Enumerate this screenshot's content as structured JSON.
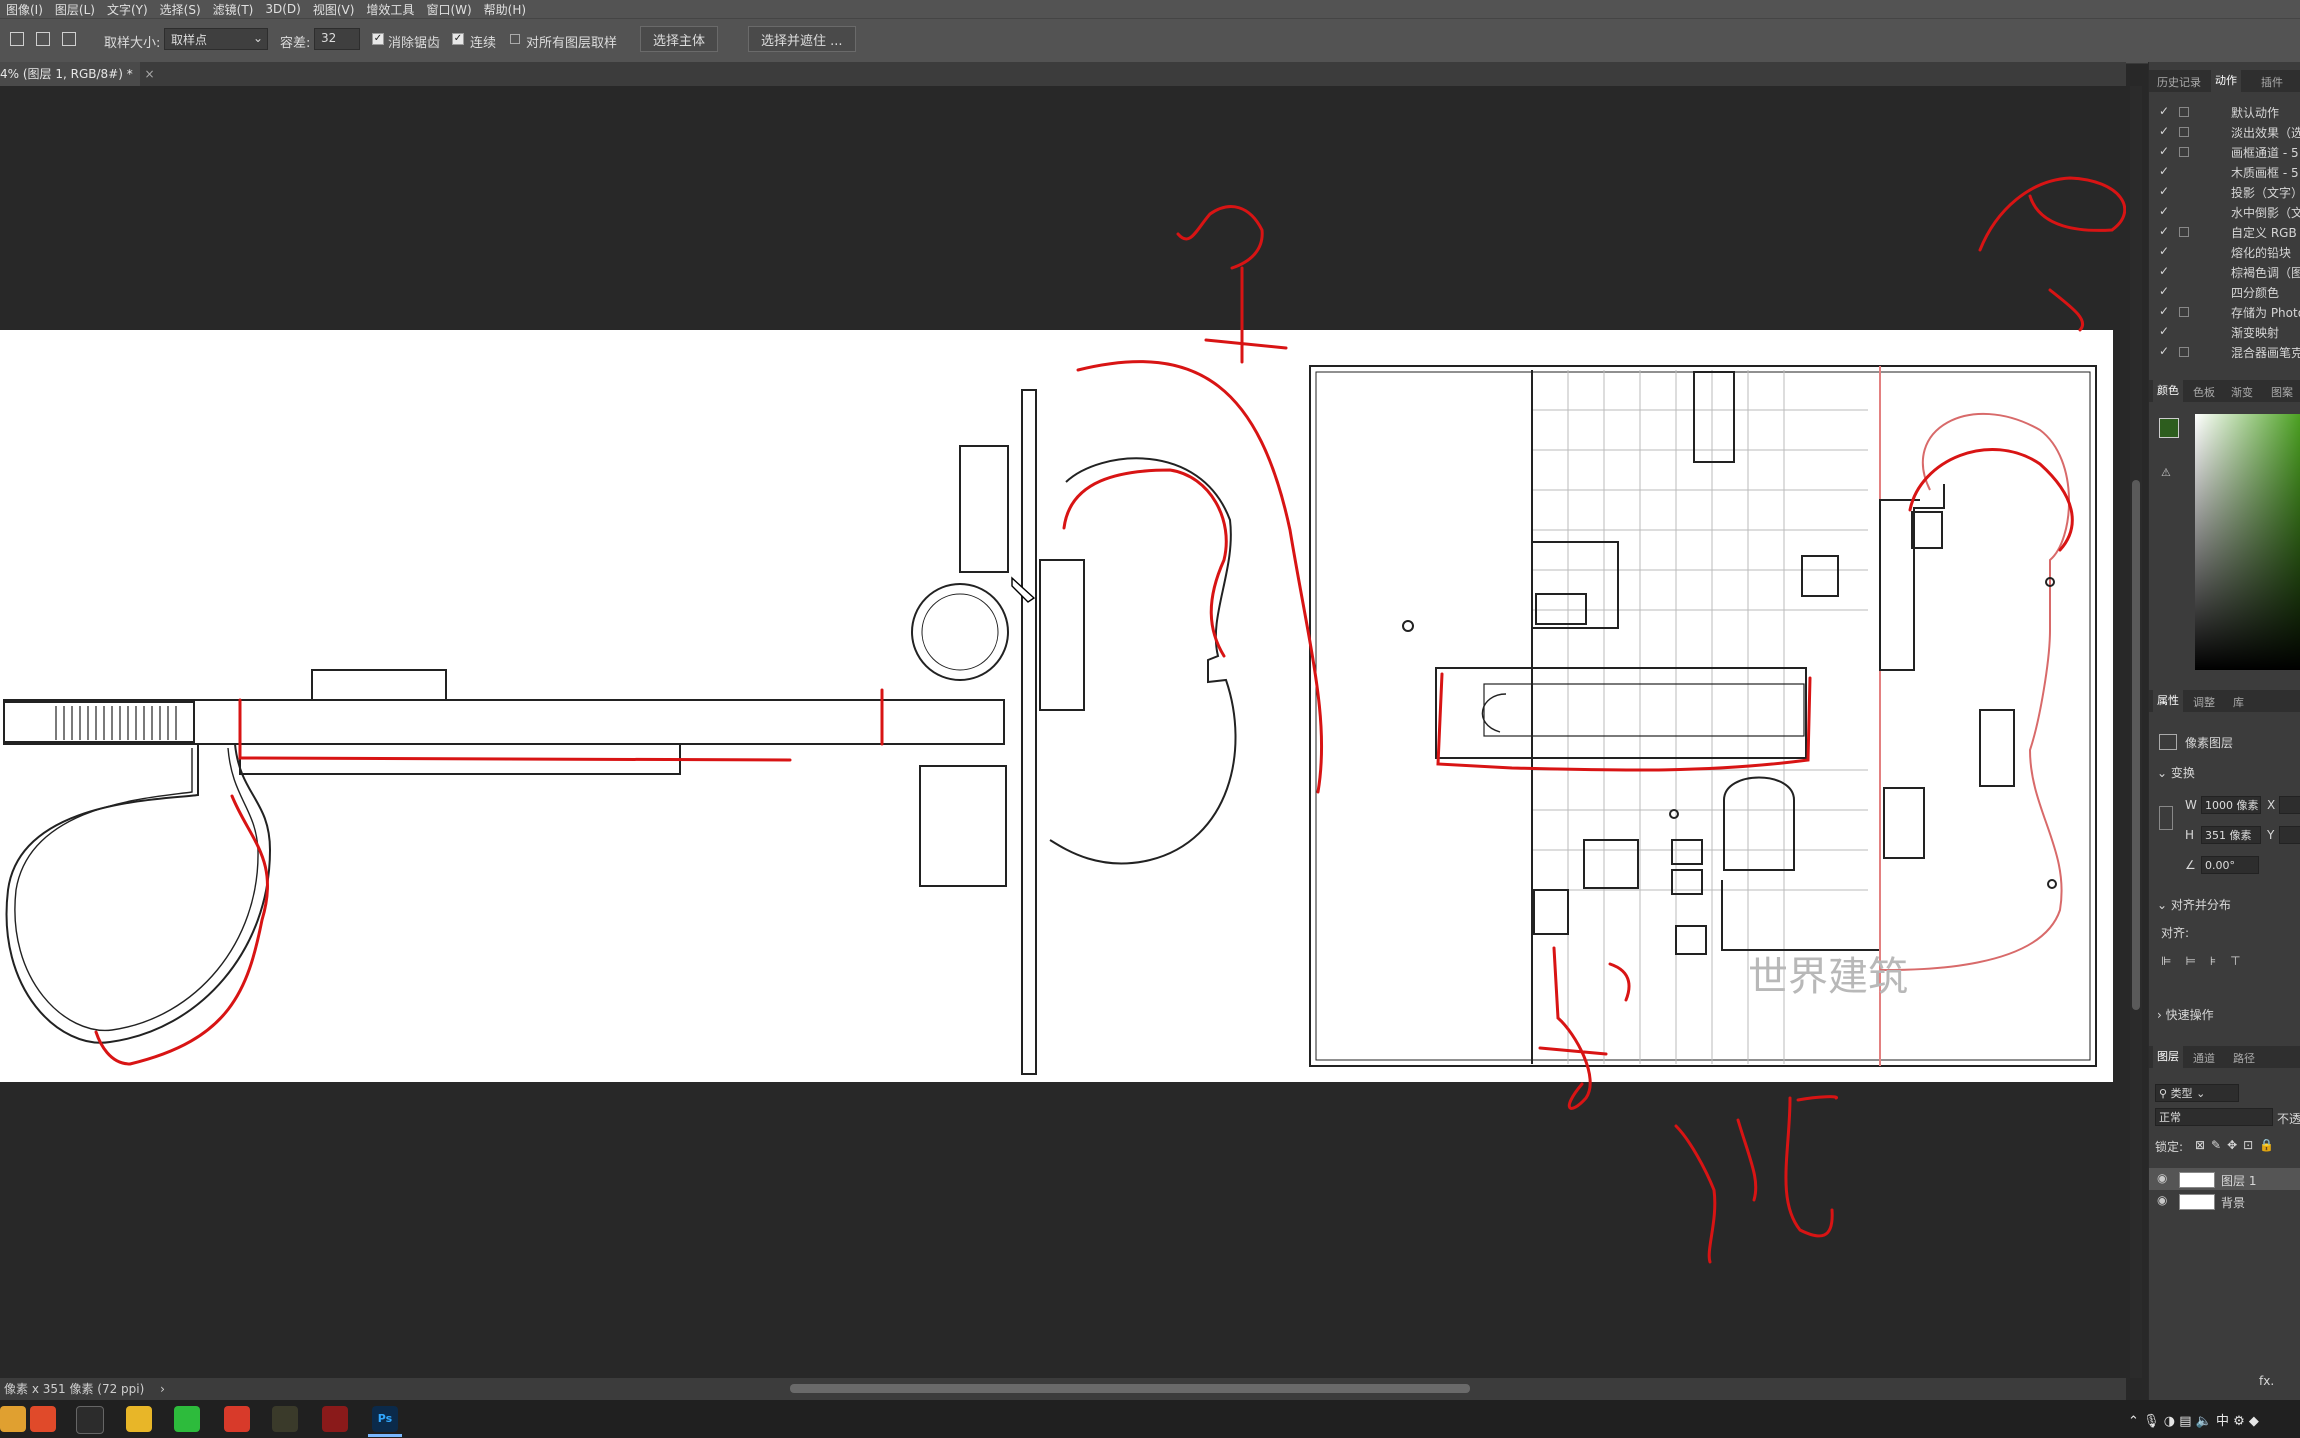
{
  "menu": [
    "图像(I)",
    "图层(L)",
    "文字(Y)",
    "选择(S)",
    "滤镜(T)",
    "3D(D)",
    "视图(V)",
    "增效工具",
    "窗口(W)",
    "帮助(H)"
  ],
  "options": {
    "sample_size_label": "取样大小:",
    "sample_size_value": "取样点",
    "tolerance_label": "容差:",
    "tolerance_value": "32",
    "antialias_label": "消除锯齿",
    "contiguous_label": "连续",
    "all_layers_label": "对所有图层取样",
    "select_subject": "选择主体",
    "select_mask": "选择并遮住 ..."
  },
  "document_tab": "4% (图层 1, RGB/8#) *",
  "status_text": "像素 x 351 像素 (72 ppi)",
  "panels": {
    "top_tabs": [
      "历史记录",
      "动作",
      "插件"
    ],
    "actions": [
      "默认动作",
      "淡出效果（选",
      "画框通道 - 5",
      "木质画框 - 5",
      "投影（文字）",
      "水中倒影（文",
      "自定义 RGB",
      "熔化的铅块",
      "棕褐色调（图",
      "四分颜色",
      "存储为 Photo",
      "渐变映射",
      "混合器画笔克"
    ],
    "color_tabs": [
      "颜色",
      "色板",
      "渐变",
      "图案"
    ],
    "props_tabs": [
      "属性",
      "调整",
      "库"
    ],
    "pixel_layer": "像素图层",
    "transform_label": "变换",
    "w_label": "W",
    "w_value": "1000 像素",
    "h_label": "H",
    "h_value": "351 像素",
    "x_label": "X",
    "y_label": "Y",
    "angle_value": "0.00°",
    "align_label": "对齐并分布",
    "align_to_label": "对齐:",
    "quick_actions": "快速操作",
    "layers_tabs": [
      "图层",
      "通道",
      "路径"
    ],
    "kind_label": "类型",
    "blend_mode": "正常",
    "opacity_label": "不透",
    "lock_label": "锁定:",
    "layers": [
      "图层 1",
      "背景"
    ]
  },
  "watermark": "世界建筑",
  "annotations": [
    "四",
    "单",
    "三",
    "卡",
    "代"
  ],
  "colors": {
    "chrome": "#535353",
    "canvas": "#282828",
    "panel": "#3c3c3c",
    "annotation_red": "#d81414",
    "foreground_swatch": "#2d5d1e"
  },
  "taskbar": {
    "apps": [
      "app-1",
      "app-2",
      "app-3",
      "file-explorer",
      "wechat",
      "app-6",
      "app-7",
      "app-8",
      "photoshop"
    ],
    "photoshop_label": "Ps",
    "ime": "中"
  }
}
